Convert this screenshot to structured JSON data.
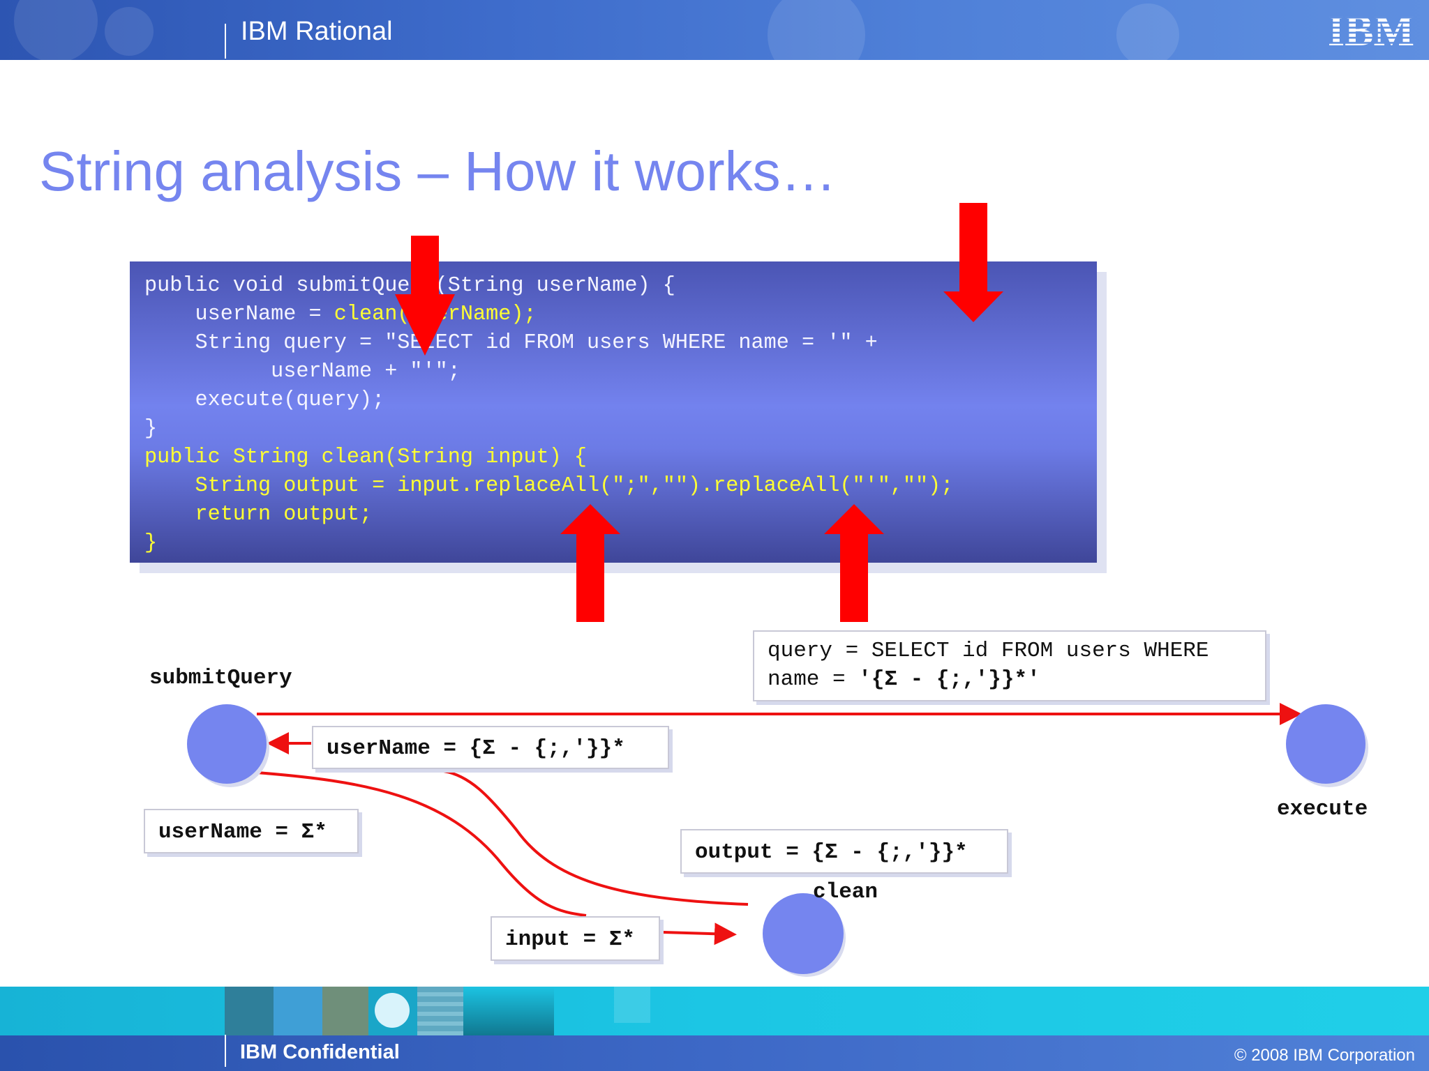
{
  "header": {
    "title": "IBM Rational",
    "logo_text": "IBM"
  },
  "slide": {
    "title": "String analysis – How it works…"
  },
  "code": {
    "lines": [
      {
        "text": "public void submitQuery(String userName) {",
        "color": "white"
      },
      {
        "text": "    userName = clean(userName);",
        "color": "mixed"
      },
      {
        "text": "    String query = \"SELECT id FROM users WHERE name = '\" +",
        "color": "white"
      },
      {
        "text": "          userName + \"'\";",
        "color": "white"
      },
      {
        "text": "    execute(query);",
        "color": "white"
      },
      {
        "text": "}",
        "color": "white"
      },
      {
        "text": "public String clean(String input) {",
        "color": "yellow"
      },
      {
        "text": "    String output = input.replaceAll(\";\",\"\").replaceAll(\"'\",\"\");",
        "color": "yellow"
      },
      {
        "text": "    return output;",
        "color": "yellow"
      },
      {
        "text": "}",
        "color": "yellow"
      }
    ],
    "line1_parts": [
      "    userName = ",
      "clean(userName);"
    ],
    "colors": {
      "default": "#f4f4ff",
      "highlight": "#ffff33"
    }
  },
  "diagram": {
    "nodes": {
      "submitQuery": "submitQuery",
      "execute": "execute",
      "clean": "clean"
    },
    "labels": {
      "query_line1": "query = SELECT id FROM users WHERE",
      "query_line2_prefix": "name = ",
      "query_line2_value": "'{Σ - {;,'}}*'",
      "userName_clean": "userName = {Σ - {;,'}}*",
      "userName_any": "userName = Σ*",
      "output": "output = {Σ - {;,'}}*",
      "input": "input = Σ*"
    },
    "colors": {
      "node": "#7585ef",
      "edge": "#ee1111",
      "arrow": "#ff0000"
    }
  },
  "footer": {
    "left": "IBM Confidential",
    "right": "© 2008 IBM Corporation"
  }
}
